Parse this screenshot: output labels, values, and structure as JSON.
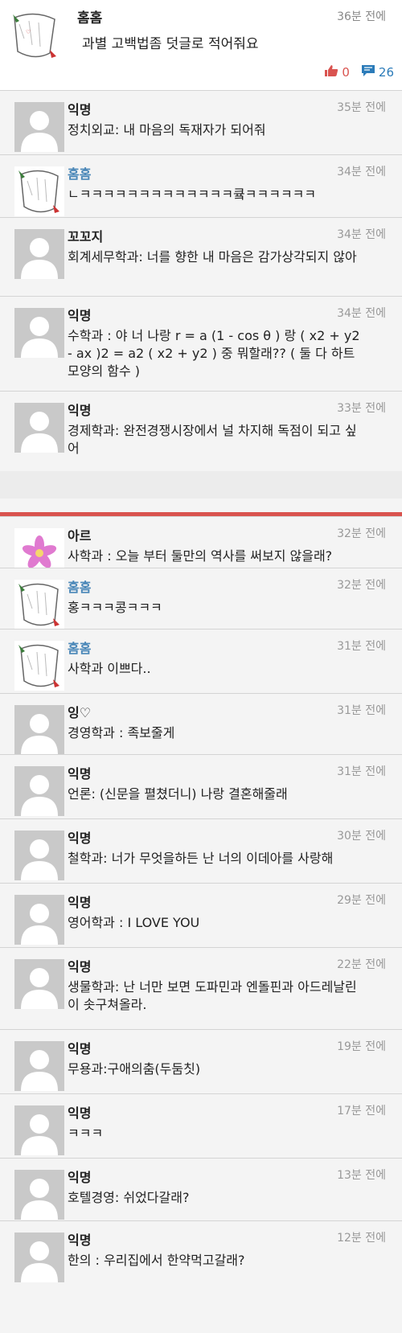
{
  "post": {
    "author": "홈홈",
    "time": "36분 전에",
    "body": "과별 고백법좀 덧글로 적어줘요",
    "likes": "0",
    "comments": "26"
  },
  "comments": [
    {
      "author": "익명",
      "time": "35분 전에",
      "body": "정치외교: 내 마음의 독재자가 되어줘",
      "avatar": "default"
    },
    {
      "author": "홈홈",
      "time": "34분 전에",
      "body": "ㄴㅋㅋㅋㅋㅋㅋㅋㅋㅋㅋㅋㅋㅋ큨ㅋㅋㅋㅋㅋㅋ",
      "avatar": "book"
    },
    {
      "author": "꼬꼬지",
      "time": "34분 전에",
      "body": "회계세무학과: 너를 향한 내 마음은 감가상각되지 않아",
      "avatar": "default"
    },
    {
      "author": "익명",
      "time": "34분 전에",
      "body": "수학과 : 야 너 나랑 r = a (1 - cos θ ) 랑 ( x2 + y2 - ax )2 = a2 ( x2 + y2 ) 중 뭐할래?? ( 둘 다 하트모양의 함수 )",
      "avatar": "default"
    },
    {
      "author": "익명",
      "time": "33분 전에",
      "body": "경제학과: 완전경쟁시장에서 널 차지해 독점이 되고 싶어",
      "avatar": "default"
    },
    {
      "author": "아르",
      "time": "32분 전에",
      "body": "사학과 : 오늘 부터 둘만의 역사를 써보지 않을래?",
      "avatar": "flower"
    },
    {
      "author": "홈홈",
      "time": "32분 전에",
      "body": "홍ㅋㅋㅋ콩ㅋㅋㅋ",
      "avatar": "book"
    },
    {
      "author": "홈홈",
      "time": "31분 전에",
      "body": "사학과 이쁘다..",
      "avatar": "book"
    },
    {
      "author": "잉♡",
      "time": "31분 전에",
      "body": "경영학과 : 족보줄게",
      "avatar": "default"
    },
    {
      "author": "익명",
      "time": "31분 전에",
      "body": "언론: (신문을 펼쳤더니) 나랑 결혼해줄래",
      "avatar": "default"
    },
    {
      "author": "익명",
      "time": "30분 전에",
      "body": "철학과: 너가 무엇을하든 난 너의 이데아를 사랑해",
      "avatar": "default"
    },
    {
      "author": "익명",
      "time": "29분 전에",
      "body": "영어학과 : I LOVE YOU",
      "avatar": "default"
    },
    {
      "author": "익명",
      "time": "22분 전에",
      "body": "생물학과: 난 너만 보면 도파민과 엔돌핀과 아드레날린이 솟구쳐올라.",
      "avatar": "default"
    },
    {
      "author": "익명",
      "time": "19분 전에",
      "body": "무용과:구애의춤(두둠칫)",
      "avatar": "default"
    },
    {
      "author": "익명",
      "time": "17분 전에",
      "body": "ㅋㅋㅋ",
      "avatar": "default"
    },
    {
      "author": "익명",
      "time": "13분 전에",
      "body": "호텔경영: 쉬었다갈래?",
      "avatar": "default"
    },
    {
      "author": "익명",
      "time": "12분 전에",
      "body": "한의 : 우리집에서 한약먹고갈래?",
      "avatar": "default"
    }
  ]
}
